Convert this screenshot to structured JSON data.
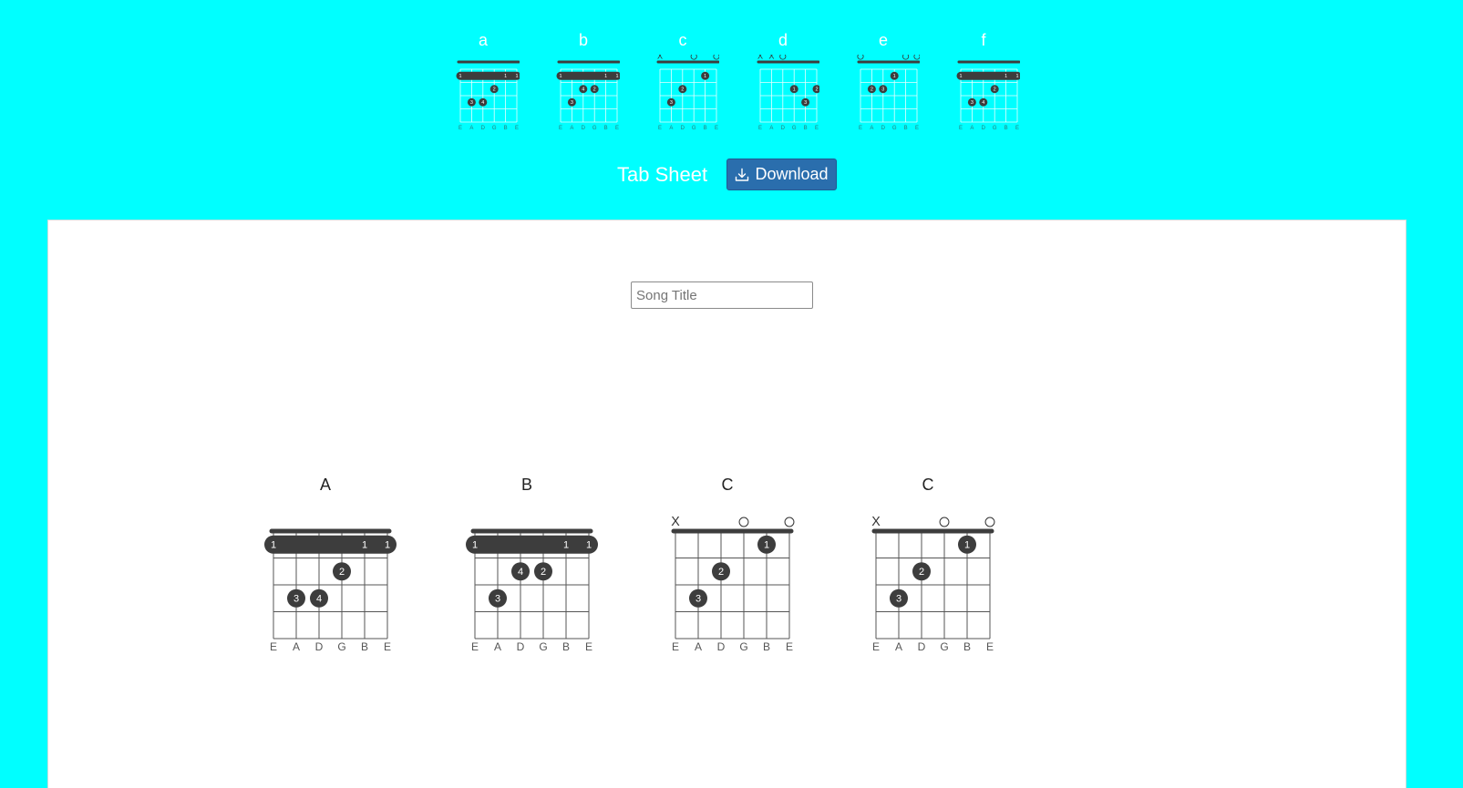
{
  "palette": {
    "chords": [
      {
        "name": "a",
        "string_marks": [
          "",
          "",
          "",
          "",
          "",
          ""
        ],
        "barre": 1,
        "dots": [
          {
            "string": 5,
            "fret": 1,
            "finger": "1"
          },
          {
            "string": 4,
            "fret": 2,
            "finger": "2"
          },
          {
            "string": 2,
            "fret": 3,
            "finger": "3"
          },
          {
            "string": 3,
            "fret": 3,
            "finger": "4"
          }
        ],
        "barre_labels": [
          {
            "string": 1,
            "finger": "1"
          },
          {
            "string": 5,
            "finger": "1"
          },
          {
            "string": 6,
            "finger": "1"
          }
        ]
      },
      {
        "name": "b",
        "string_marks": [
          "",
          "",
          "",
          "",
          "",
          ""
        ],
        "barre": 1,
        "dots": [
          {
            "string": 3,
            "fret": 2,
            "finger": "4"
          },
          {
            "string": 4,
            "fret": 2,
            "finger": "2"
          },
          {
            "string": 2,
            "fret": 3,
            "finger": "3"
          }
        ],
        "barre_labels": [
          {
            "string": 1,
            "finger": "1"
          },
          {
            "string": 5,
            "finger": "1"
          },
          {
            "string": 6,
            "finger": "1"
          }
        ]
      },
      {
        "name": "c",
        "string_marks": [
          "X",
          "",
          "",
          "O",
          "",
          "O"
        ],
        "barre": 0,
        "dots": [
          {
            "string": 5,
            "fret": 1,
            "finger": "1"
          },
          {
            "string": 3,
            "fret": 2,
            "finger": "2"
          },
          {
            "string": 2,
            "fret": 3,
            "finger": "3"
          }
        ],
        "barre_labels": []
      },
      {
        "name": "d",
        "string_marks": [
          "X",
          "X",
          "O",
          "",
          "",
          ""
        ],
        "barre": 0,
        "dots": [
          {
            "string": 4,
            "fret": 2,
            "finger": "1"
          },
          {
            "string": 6,
            "fret": 2,
            "finger": "2"
          },
          {
            "string": 5,
            "fret": 3,
            "finger": "3"
          }
        ],
        "barre_labels": []
      },
      {
        "name": "e",
        "string_marks": [
          "O",
          "",
          "",
          "",
          "O",
          "O"
        ],
        "barre": 0,
        "dots": [
          {
            "string": 4,
            "fret": 1,
            "finger": "1"
          },
          {
            "string": 2,
            "fret": 2,
            "finger": "2"
          },
          {
            "string": 3,
            "fret": 2,
            "finger": "3"
          }
        ],
        "barre_labels": []
      },
      {
        "name": "f",
        "string_marks": [
          "",
          "",
          "",
          "",
          "",
          ""
        ],
        "barre": 1,
        "dots": [
          {
            "string": 4,
            "fret": 2,
            "finger": "2"
          },
          {
            "string": 2,
            "fret": 3,
            "finger": "3"
          },
          {
            "string": 3,
            "fret": 3,
            "finger": "4"
          }
        ],
        "barre_labels": [
          {
            "string": 1,
            "finger": "1"
          },
          {
            "string": 5,
            "finger": "1"
          },
          {
            "string": 6,
            "finger": "1"
          }
        ]
      }
    ]
  },
  "string_names": [
    "E",
    "A",
    "D",
    "G",
    "B",
    "E"
  ],
  "tab_sheet": {
    "title": "Tab Sheet",
    "download_label": "Download",
    "download_icon": "download-icon",
    "song_title_placeholder": "Song Title",
    "song_title_value": ""
  },
  "sheet_chords": [
    {
      "name": "A",
      "string_marks": [
        "",
        "",
        "",
        "",
        "",
        ""
      ],
      "barre": 1,
      "dots": [
        {
          "string": 4,
          "fret": 2,
          "finger": "2"
        },
        {
          "string": 2,
          "fret": 3,
          "finger": "3"
        },
        {
          "string": 3,
          "fret": 3,
          "finger": "4"
        }
      ],
      "barre_labels": [
        {
          "string": 1,
          "finger": "1"
        },
        {
          "string": 5,
          "finger": "1"
        },
        {
          "string": 6,
          "finger": "1"
        }
      ]
    },
    {
      "name": "B",
      "string_marks": [
        "",
        "",
        "",
        "",
        "",
        ""
      ],
      "barre": 1,
      "dots": [
        {
          "string": 3,
          "fret": 2,
          "finger": "4"
        },
        {
          "string": 4,
          "fret": 2,
          "finger": "2"
        },
        {
          "string": 2,
          "fret": 3,
          "finger": "3"
        }
      ],
      "barre_labels": [
        {
          "string": 1,
          "finger": "1"
        },
        {
          "string": 5,
          "finger": "1"
        },
        {
          "string": 6,
          "finger": "1"
        }
      ]
    },
    {
      "name": "C",
      "string_marks": [
        "X",
        "",
        "",
        "O",
        "",
        "O"
      ],
      "barre": 0,
      "dots": [
        {
          "string": 5,
          "fret": 1,
          "finger": "1"
        },
        {
          "string": 3,
          "fret": 2,
          "finger": "2"
        },
        {
          "string": 2,
          "fret": 3,
          "finger": "3"
        }
      ],
      "barre_labels": []
    },
    {
      "name": "C",
      "string_marks": [
        "X",
        "",
        "",
        "O",
        "",
        "O"
      ],
      "barre": 0,
      "dots": [
        {
          "string": 5,
          "fret": 1,
          "finger": "1"
        },
        {
          "string": 3,
          "fret": 2,
          "finger": "2"
        },
        {
          "string": 2,
          "fret": 3,
          "finger": "3"
        }
      ],
      "barre_labels": []
    }
  ],
  "colors": {
    "background": "#00ffff",
    "palette_ink": "#f4ffff",
    "sheet_ink": "#555555",
    "dot_fill": "#3d3d3d",
    "button": "#2a6ead"
  }
}
